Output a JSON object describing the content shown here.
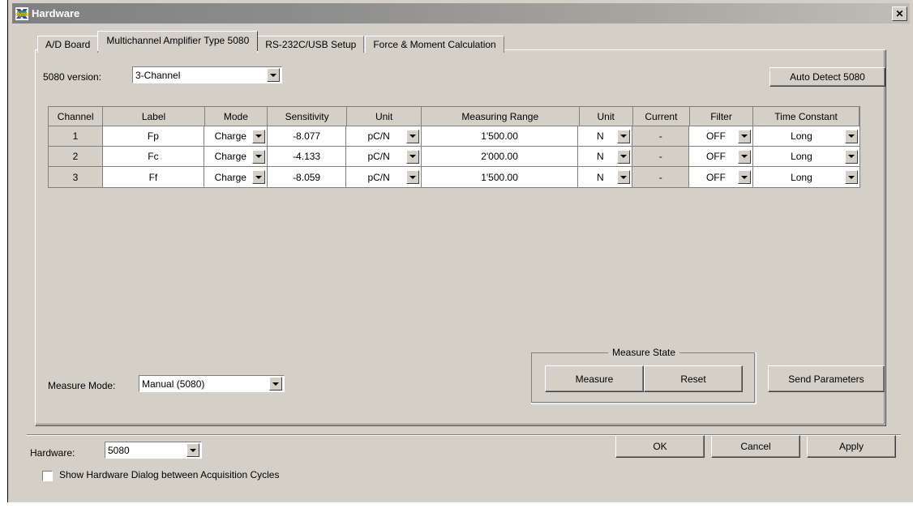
{
  "window": {
    "title": "Hardware",
    "icon": "dyna-logo-icon",
    "close_label": "✕"
  },
  "tabs": [
    {
      "label": "A/D Board",
      "selected": false
    },
    {
      "label": "Multichannel Amplifier Type 5080",
      "selected": true
    },
    {
      "label": "RS-232C/USB Setup",
      "selected": false
    },
    {
      "label": "Force & Moment Calculation",
      "selected": false
    }
  ],
  "panel": {
    "version_label": "5080 version:",
    "version_value": "3-Channel",
    "auto_detect_label": "Auto Detect 5080",
    "measure_mode_label": "Measure Mode:",
    "measure_mode_value": "Manual (5080)",
    "measure_state_title": "Measure State",
    "measure_button": "Measure",
    "reset_button": "Reset",
    "send_parameters_button": "Send Parameters"
  },
  "grid": {
    "columns": [
      "Channel",
      "Label",
      "Mode",
      "Sensitivity",
      "Unit",
      "Measuring Range",
      "Unit",
      "Current",
      "Filter",
      "Time Constant"
    ],
    "rows": [
      {
        "channel": "1",
        "label": "Fp",
        "mode": "Charge",
        "sensitivity": "-8.077",
        "sens_unit": "pC/N",
        "range": "1'500.00",
        "range_unit": "N",
        "current": "-",
        "filter": "OFF",
        "time_constant": "Long"
      },
      {
        "channel": "2",
        "label": "Fc",
        "mode": "Charge",
        "sensitivity": "-4.133",
        "sens_unit": "pC/N",
        "range": "2'000.00",
        "range_unit": "N",
        "current": "-",
        "filter": "OFF",
        "time_constant": "Long"
      },
      {
        "channel": "3",
        "label": "Ff",
        "mode": "Charge",
        "sensitivity": "-8.059",
        "sens_unit": "pC/N",
        "range": "1'500.00",
        "range_unit": "N",
        "current": "-",
        "filter": "OFF",
        "time_constant": "Long"
      }
    ]
  },
  "footer": {
    "hardware_label": "Hardware:",
    "hardware_value": "5080",
    "show_dialog_label": "Show Hardware Dialog between Acquisition Cycles",
    "show_dialog_checked": false,
    "ok_label": "OK",
    "cancel_label": "Cancel",
    "apply_label": "Apply"
  },
  "colors": {
    "face": "#d4d0c8",
    "shadow": "#808080",
    "dark": "#404040",
    "light": "#ffffff",
    "title_text": "#ffffff"
  }
}
